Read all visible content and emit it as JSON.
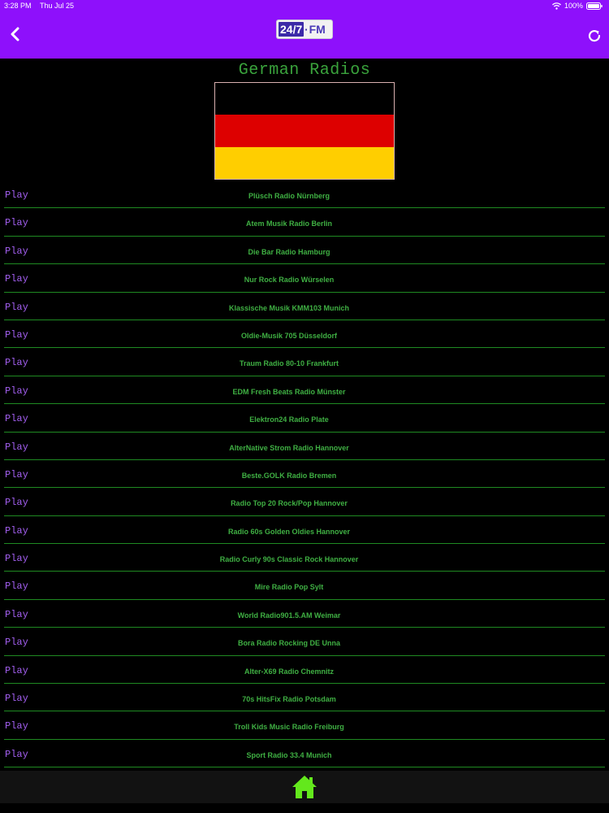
{
  "status_bar": {
    "time": "3:28 PM",
    "date": "Thu Jul 25",
    "battery": "100%"
  },
  "header": {
    "logo_main": "24/7",
    "logo_fm": "FM",
    "background_color": "#8e10fb"
  },
  "page": {
    "title": "German Radios"
  },
  "flag": {
    "colors": [
      "#000000",
      "#dd0000",
      "#ffce00"
    ]
  },
  "stations": [
    {
      "play": "Play",
      "name": "Plüsch Radio Nürnberg"
    },
    {
      "play": "Play",
      "name": "Atem Musik Radio Berlin"
    },
    {
      "play": "Play",
      "name": "Die Bar Radio Hamburg"
    },
    {
      "play": "Play",
      "name": "Nur Rock Radio Würselen"
    },
    {
      "play": "Play",
      "name": "Klassische Musik KMM103 Munich"
    },
    {
      "play": "Play",
      "name": "Oldie-Musik 705 Düsseldorf"
    },
    {
      "play": "Play",
      "name": "Traum Radio 80-10 Frankfurt"
    },
    {
      "play": "Play",
      "name": "EDM Fresh Beats Radio Münster"
    },
    {
      "play": "Play",
      "name": "Elektron24 Radio Plate"
    },
    {
      "play": "Play",
      "name": "AlterNative Strom Radio Hannover"
    },
    {
      "play": "Play",
      "name": "Beste.GOLK Radio Bremen"
    },
    {
      "play": "Play",
      "name": "Radio Top 20 Rock/Pop Hannover"
    },
    {
      "play": "Play",
      "name": "Radio 60s Golden Oldies Hannover"
    },
    {
      "play": "Play",
      "name": "Radio Curly 90s Classic Rock Hannover"
    },
    {
      "play": "Play",
      "name": "Mire Radio Pop Sylt"
    },
    {
      "play": "Play",
      "name": "World Radio901.5.AM Weimar"
    },
    {
      "play": "Play",
      "name": "Bora Radio Rocking DE Unna"
    },
    {
      "play": "Play",
      "name": "Alter-X69 Radio Chemnitz"
    },
    {
      "play": "Play",
      "name": "70s HitsFix Radio Potsdam"
    },
    {
      "play": "Play",
      "name": "Troll Kids Music Radio Freiburg"
    },
    {
      "play": "Play",
      "name": "Sport Radio 33.4 Munich"
    }
  ],
  "icons": {
    "back": "chevron-left-icon",
    "refresh": "refresh-icon",
    "home": "home-icon"
  }
}
